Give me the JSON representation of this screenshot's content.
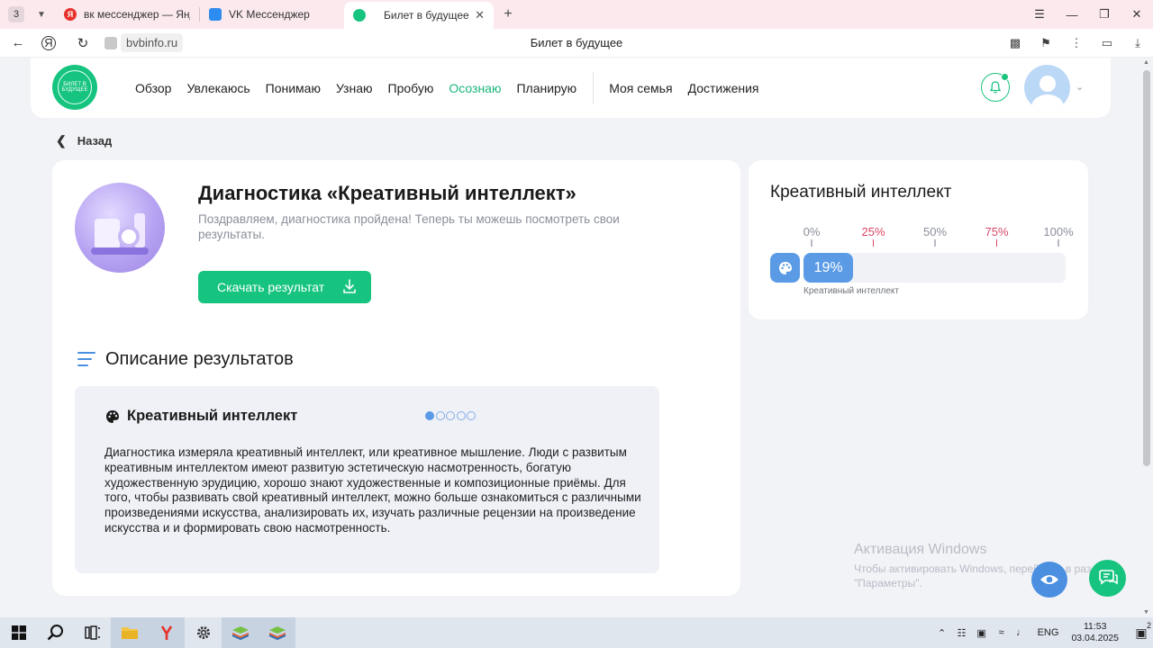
{
  "browser": {
    "tab_count": "3",
    "tabs": [
      {
        "title": "вк мессенджер — Яндекс",
        "favicon": "yandex-icon",
        "color": "#e8322c"
      },
      {
        "title": "VK Мессенджер",
        "favicon": "vk-messenger-icon",
        "color": "#2d8cf0"
      },
      {
        "title": "Билет в будущее",
        "favicon": "bvb-icon",
        "color": "#16c47f"
      }
    ],
    "url": "bvbinfo.ru",
    "page_title": "Билет в будущее"
  },
  "header": {
    "logo_text": "БИЛЕТ В БУДУЩЕЕ",
    "nav": [
      {
        "label": "Обзор",
        "active": false
      },
      {
        "label": "Увлекаюсь",
        "active": false
      },
      {
        "label": "Понимаю",
        "active": false
      },
      {
        "label": "Узнаю",
        "active": false
      },
      {
        "label": "Пробую",
        "active": false
      },
      {
        "label": "Осознаю",
        "active": true
      },
      {
        "label": "Планирую",
        "active": false
      }
    ],
    "nav_secondary": [
      "Моя семья",
      "Достижения"
    ]
  },
  "back_label": "Назад",
  "diagnostic": {
    "title": "Диагностика «Креативный интеллект»",
    "subtitle": "Поздравляем, диагностика пройдена! Теперь ты можешь посмотреть свои результаты.",
    "download_label": "Скачать результат"
  },
  "description": {
    "section_title": "Описание результатов",
    "card_heading": "Креативный интеллект",
    "pager": {
      "total": 5,
      "active": 0
    },
    "text": "Диагностика измеряла креативный интеллект, или креативное мышление. Люди с развитым креативным интеллектом имеют развитую эстетическую насмотренность, богатую художественную эрудицию, хорошо знают художественные и композиционные приёмы. Для того, чтобы развивать свой креативный интеллект, можно больше ознакомиться с различными произведениями искусства, анализировать их, изучать различные рецензии на произведение искусства и и формировать свою насмотренность."
  },
  "result": {
    "title": "Креативный интеллект",
    "scale": [
      {
        "label": "0%",
        "highlight": false
      },
      {
        "label": "25%",
        "highlight": true
      },
      {
        "label": "50%",
        "highlight": false
      },
      {
        "label": "75%",
        "highlight": true
      },
      {
        "label": "100%",
        "highlight": false
      }
    ],
    "value_percent": 19,
    "value_label": "19%",
    "caption": "Креативный интеллект",
    "accent": "#5b9be6"
  },
  "watermark": {
    "title": "Активация Windows",
    "subtitle": "Чтобы активировать Windows, перейдите в раздел \"Параметры\"."
  },
  "taskbar": {
    "lang": "ENG",
    "time": "11:53",
    "date": "03.04.2025",
    "notifications": "2"
  },
  "colors": {
    "brand_green": "#16c47f",
    "link_blue": "#4a8fe0",
    "highlight_red": "#d94766"
  }
}
